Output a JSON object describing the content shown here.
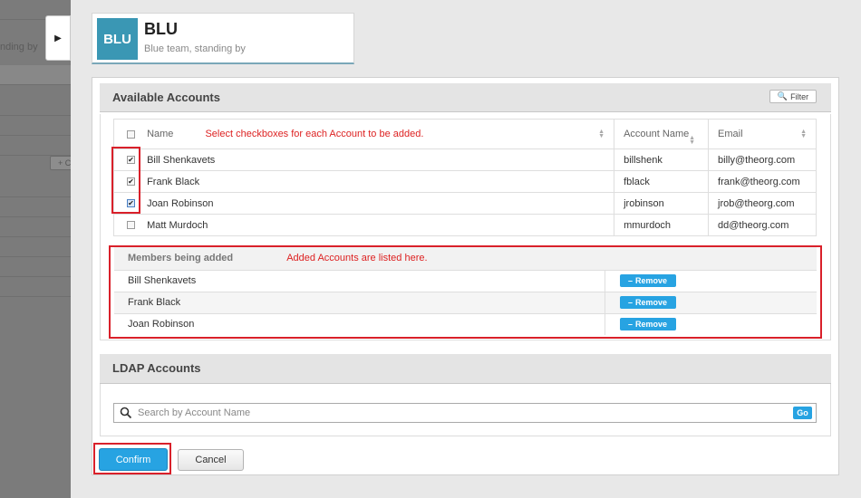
{
  "background": {
    "partial_text": "nding by",
    "partial_button": "+ C"
  },
  "team": {
    "logo_text": "BLU",
    "name": "BLU",
    "status": "Blue team, standing by",
    "logo_color": "#3a97b4"
  },
  "available_accounts": {
    "title": "Available Accounts",
    "filter_label": "Filter",
    "hint": "Select checkboxes for each Account to be added.",
    "columns": [
      "Name",
      "Account Name",
      "Email"
    ],
    "rows": [
      {
        "name": "Bill Shenkavets",
        "account": "billshenk",
        "email": "billy@theorg.com",
        "checked": true
      },
      {
        "name": "Frank Black",
        "account": "fblack",
        "email": "frank@theorg.com",
        "checked": true
      },
      {
        "name": "Joan Robinson",
        "account": "jrobinson",
        "email": "jrob@theorg.com",
        "checked": true
      },
      {
        "name": "Matt Murdoch",
        "account": "mmurdoch",
        "email": "dd@theorg.com",
        "checked": false
      }
    ]
  },
  "members": {
    "header": "Members being added",
    "hint": "Added Accounts are listed here.",
    "remove_label": "Remove",
    "items": [
      "Bill Shenkavets",
      "Frank Black",
      "Joan Robinson"
    ]
  },
  "ldap": {
    "title": "LDAP Accounts",
    "placeholder": "Search by Account Name",
    "go_label": "Go"
  },
  "actions": {
    "confirm_label": "Confirm",
    "cancel_label": "Cancel"
  },
  "colors": {
    "accent": "#27a3e2",
    "annotation_red": "#d9202a"
  }
}
